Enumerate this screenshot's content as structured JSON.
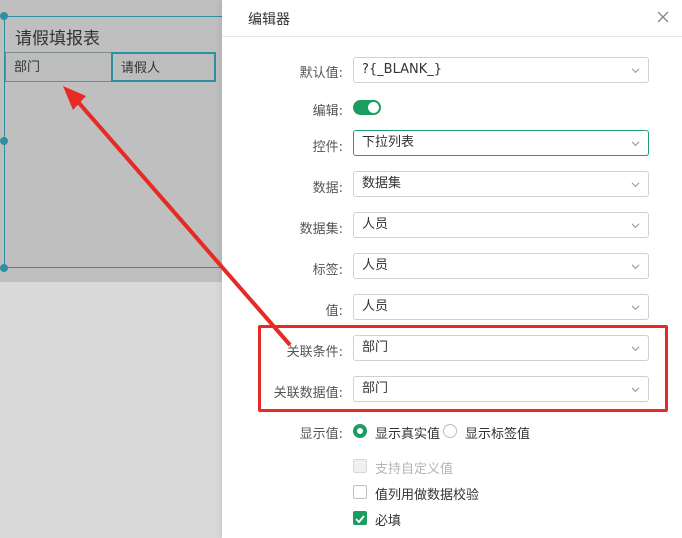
{
  "canvas": {
    "report_title": "请假填报表",
    "cells": [
      "部门",
      "请假人"
    ]
  },
  "panel": {
    "title": "编辑器",
    "fields": {
      "default_value": {
        "label": "默认值:",
        "value": "?{_BLANK_}"
      },
      "editable": {
        "label": "编辑:",
        "on": true
      },
      "control": {
        "label": "控件:",
        "value": "下拉列表"
      },
      "data": {
        "label": "数据:",
        "value": "数据集"
      },
      "dataset": {
        "label": "数据集:",
        "value": "人员"
      },
      "tag": {
        "label": "标签:",
        "value": "人员"
      },
      "value": {
        "label": "值:",
        "value": "人员"
      },
      "relation_condition": {
        "label": "关联条件:",
        "value": "部门"
      },
      "relation_data_value": {
        "label": "关联数据值:",
        "value": "部门"
      },
      "display_value": {
        "label": "显示值:",
        "options": [
          "显示真实值",
          "显示标签值"
        ],
        "selected": "显示真实值"
      }
    },
    "checkboxes": [
      {
        "label": "支持自定义值",
        "state": "disabled"
      },
      {
        "label": "值列用做数据校验",
        "state": "unchecked"
      },
      {
        "label": "必填",
        "state": "checked"
      }
    ]
  },
  "colors": {
    "accent": "#1a9e5f",
    "annotation": "#e62a24",
    "selection": "#2f8fa0"
  }
}
